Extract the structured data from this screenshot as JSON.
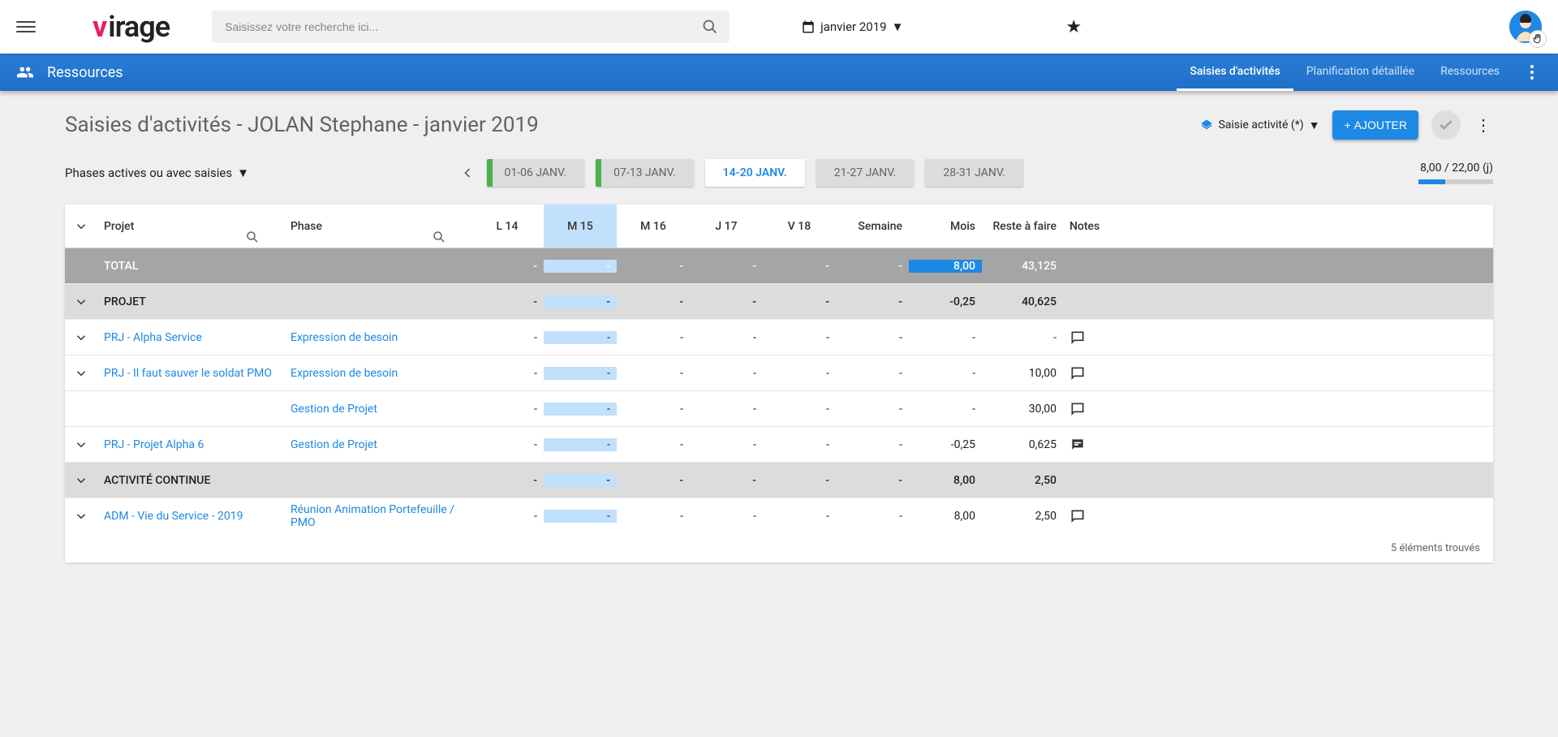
{
  "topbar": {
    "search_placeholder": "Saisissez votre recherche ici...",
    "month_label": "janvier 2019"
  },
  "nav": {
    "section": "Ressources",
    "tabs": [
      "Saisies d'activités",
      "Planification détaillée",
      "Ressources"
    ],
    "active_tab": 0
  },
  "page": {
    "title": "Saisies d'activités - JOLAN Stephane - janvier 2019",
    "view_label": "Saisie activité (*)",
    "add_label": "AJOUTER",
    "filter_label": "Phases actives ou avec saisies"
  },
  "weeks": [
    {
      "label": "01-06 JANV.",
      "bar": true,
      "active": false
    },
    {
      "label": "07-13 JANV.",
      "bar": true,
      "active": false
    },
    {
      "label": "14-20 JANV.",
      "bar": false,
      "active": true
    },
    {
      "label": "21-27 JANV.",
      "bar": false,
      "active": false
    },
    {
      "label": "28-31 JANV.",
      "bar": false,
      "active": false
    }
  ],
  "progress": {
    "text": "8,00 / 22,00 (j)",
    "pct": 36
  },
  "columns": {
    "project": "Projet",
    "phase": "Phase",
    "days": [
      "L 14",
      "M 15",
      "M 16",
      "J 17",
      "V 18"
    ],
    "week": "Semaine",
    "month": "Mois",
    "rest": "Reste à faire",
    "notes": "Notes",
    "highlight_index": 1
  },
  "totals": {
    "label": "TOTAL",
    "days": [
      "-",
      "-",
      "-",
      "-",
      "-"
    ],
    "week": "-",
    "month": "8,00",
    "rest": "43,125"
  },
  "groups": [
    {
      "label": "PROJET",
      "days": [
        "-",
        "-",
        "-",
        "-",
        "-"
      ],
      "week": "-",
      "month": "-0,25",
      "rest": "40,625",
      "rows": [
        {
          "project": "PRJ - Alpha Service",
          "phases": [
            {
              "name": "Expression de besoin",
              "days": [
                "-",
                "-",
                "-",
                "-",
                "-"
              ],
              "week": "-",
              "month": "-",
              "rest": "-",
              "note": "empty"
            }
          ]
        },
        {
          "project": "PRJ - Il faut sauver le soldat PMO",
          "phases": [
            {
              "name": "Expression de besoin",
              "days": [
                "-",
                "-",
                "-",
                "-",
                "-"
              ],
              "week": "-",
              "month": "-",
              "rest": "10,00",
              "note": "empty"
            },
            {
              "name": "Gestion de Projet",
              "days": [
                "-",
                "-",
                "-",
                "-",
                "-"
              ],
              "week": "-",
              "month": "-",
              "rest": "30,00",
              "note": "empty"
            }
          ]
        },
        {
          "project": "PRJ - Projet Alpha 6",
          "phases": [
            {
              "name": "Gestion de Projet",
              "days": [
                "-",
                "-",
                "-",
                "-",
                "-"
              ],
              "week": "-",
              "month": "-0,25",
              "rest": "0,625",
              "note": "filled"
            }
          ]
        }
      ]
    },
    {
      "label": "ACTIVITÉ CONTINUE",
      "days": [
        "-",
        "-",
        "-",
        "-",
        "-"
      ],
      "week": "-",
      "month": "8,00",
      "rest": "2,50",
      "rows": [
        {
          "project": "ADM - Vie du Service - 2019",
          "phases": [
            {
              "name": "Réunion Animation Portefeuille / PMO",
              "days": [
                "-",
                "-",
                "-",
                "-",
                "-"
              ],
              "week": "-",
              "month": "8,00",
              "rest": "2,50",
              "note": "empty"
            }
          ]
        }
      ]
    }
  ],
  "footer": "5 éléments trouvés"
}
